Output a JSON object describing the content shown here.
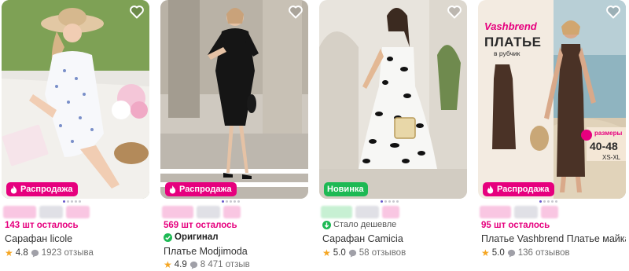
{
  "products": [
    {
      "badge": "Распродажа",
      "badge_type": "sale",
      "remaining": "143 шт осталось",
      "name": "Сарафан licole",
      "rating": "4.8",
      "reviews": "1923 отзыва",
      "price_blur_colors": [
        "#f9c6e2",
        "#e0e0e6",
        "#f9c6e2"
      ]
    },
    {
      "badge": "Распродажа",
      "badge_type": "sale",
      "remaining": "569 шт осталось",
      "original_label": "Оригинал",
      "name": "Платье Modjimoda",
      "rating": "4.9",
      "reviews": "8 471 отзыв",
      "price_blur_colors": [
        "#f9c6e2",
        "#e0e0e6",
        "#f9c6e2"
      ]
    },
    {
      "badge": "Новинка",
      "badge_type": "new",
      "cheaper_label": "Стало дешевле",
      "name": "Сарафан Camicia",
      "rating": "5.0",
      "reviews": "58 отзывов",
      "price_blur_colors": [
        "#c7f0d3",
        "#e0e0e6",
        "#f9c6e2"
      ]
    },
    {
      "badge": "Распродажа",
      "badge_type": "sale",
      "remaining": "95 шт осталось",
      "name": "Платье Vashbrend Платье майка",
      "rating": "5.0",
      "reviews": "136 отзывов",
      "price_blur_colors": [
        "#f9c6e2",
        "#e0e0e6",
        "#f9c6e2"
      ],
      "ad": {
        "brand": "Vashbrend",
        "title": "ПЛАТЬЕ",
        "subtitle": "в рубчик",
        "sizes_label": "размеры",
        "sizes": "40-48",
        "sizes_letters": "XS-XL"
      }
    }
  ],
  "icons": {
    "favorite": "heart-outline-icon",
    "sale": "fire-icon",
    "original": "check-circle-icon",
    "cheaper": "arrow-down-circle-icon",
    "rating": "star-icon",
    "reviews": "speech-bubble-icon"
  },
  "colors": {
    "sale_badge": "#e6007e",
    "new_badge": "#1db954",
    "remaining_text": "#e6007e",
    "star": "#f5a623"
  }
}
